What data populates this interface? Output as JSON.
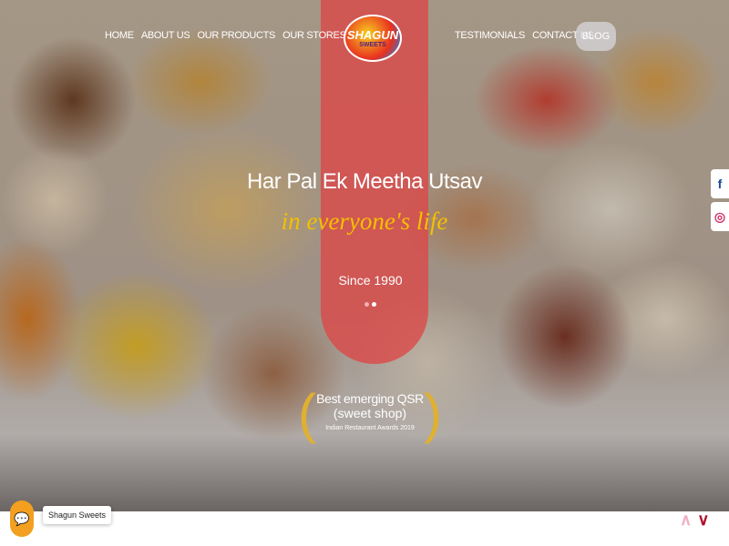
{
  "nav": {
    "left": [
      "HOME",
      "ABOUT US",
      "OUR PRODUCTS",
      "OUR STORES"
    ],
    "right": [
      "TESTIMONIALS",
      "CONTACT US"
    ],
    "blog": "BLOG"
  },
  "logo": {
    "name": "SHAGUN",
    "sub": "SWEETS"
  },
  "hero": {
    "title": "Har Pal Ek Meetha Utsav",
    "subtitle": "in everyone's life",
    "since": "Since 1990",
    "slides": 2,
    "active_slide": 2
  },
  "award": {
    "line1": "Best emerging QSR",
    "line2": "(sweet shop)",
    "line3": "Indian Restaurant Awards 2019"
  },
  "social": [
    {
      "icon": "facebook-icon",
      "glyph": "f",
      "color": "#1a4a9a"
    },
    {
      "icon": "instagram-icon",
      "glyph": "◎",
      "color": "#d0306a"
    }
  ],
  "chat": {
    "label": "Shagun Sweets",
    "color": "#f3a020"
  },
  "scroll": {
    "up": "∧",
    "down": "∨",
    "up_color": "#f0b0c0",
    "down_color": "#b01030"
  }
}
